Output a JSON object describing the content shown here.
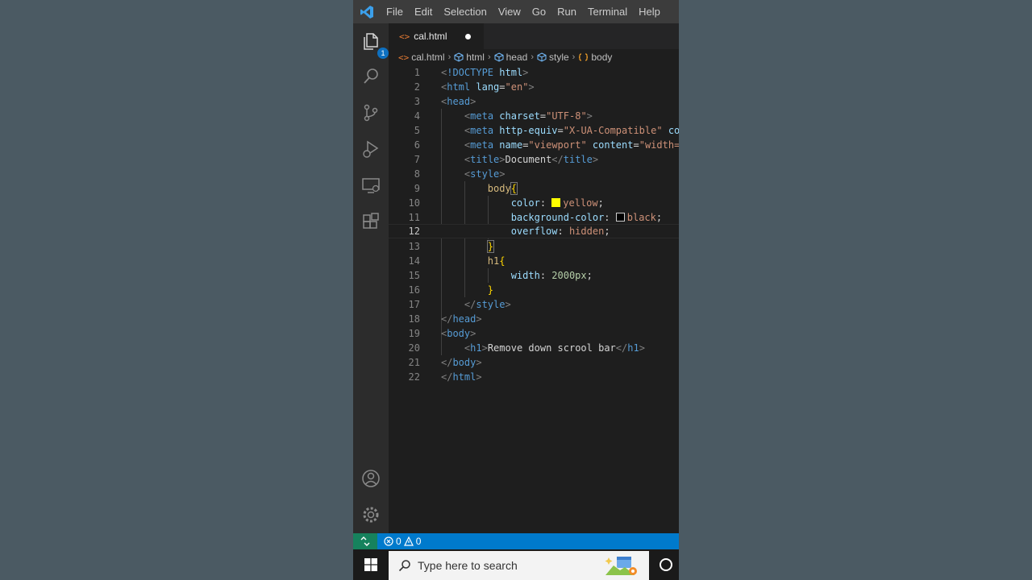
{
  "titlebar": {
    "logo_icon": "vscode-logo-icon",
    "menu": [
      "File",
      "Edit",
      "Selection",
      "View",
      "Go",
      "Run",
      "Terminal",
      "Help"
    ]
  },
  "activitybar": {
    "explorer_badge": "1",
    "icons": [
      "explorer-icon",
      "search-icon",
      "source-control-icon",
      "run-debug-icon",
      "remote-explorer-icon",
      "extensions-icon",
      "account-icon",
      "settings-gear-icon"
    ]
  },
  "tab": {
    "icon": "<>",
    "name": "cal.html",
    "modified": true
  },
  "breadcrumb": {
    "items": [
      {
        "icon": "<>",
        "label": "cal.html"
      },
      {
        "icon": "cube",
        "label": "html"
      },
      {
        "icon": "cube",
        "label": "head"
      },
      {
        "icon": "cube",
        "label": "style"
      },
      {
        "icon": "brace",
        "label": "body"
      }
    ]
  },
  "editor": {
    "active_line": 12,
    "line_numbers": [
      "1",
      "2",
      "3",
      "4",
      "5",
      "6",
      "7",
      "8",
      "9",
      "10",
      "11",
      "12",
      "13",
      "14",
      "15",
      "16",
      "17",
      "18",
      "19",
      "20",
      "21",
      "22"
    ],
    "lines": [
      "<!DOCTYPE html>",
      "<html lang=\"en\">",
      "<head>",
      "    <meta charset=\"UTF-8\">",
      "    <meta http-equiv=\"X-UA-Compatible\" co",
      "    <meta name=\"viewport\" content=\"width=",
      "    <title>Document</title>",
      "    <style>",
      "        body{",
      "            color: yellow;",
      "            background-color: black;",
      "            overflow: hidden;",
      "        }",
      "        h1{",
      "            width: 2000px;",
      "        }",
      "    </style>",
      "</head>",
      "<body>",
      "    <h1>Remove down scrool bar</h1>",
      "</body>",
      "</html>"
    ],
    "swatch_colors": {
      "yellow": "#ffff00",
      "black": "#000000"
    }
  },
  "statusbar": {
    "remote_icon": "remote-icon",
    "errors": "0",
    "warnings": "0"
  },
  "taskbar": {
    "start_icon": "windows-logo-icon",
    "search_placeholder": "Type here to search",
    "cortana_icon": "cortana-circle-icon"
  },
  "colors": {
    "background": "#4b5a63",
    "statusbar": "#007acc",
    "remote": "#16825d",
    "badge": "#0e70c0"
  }
}
